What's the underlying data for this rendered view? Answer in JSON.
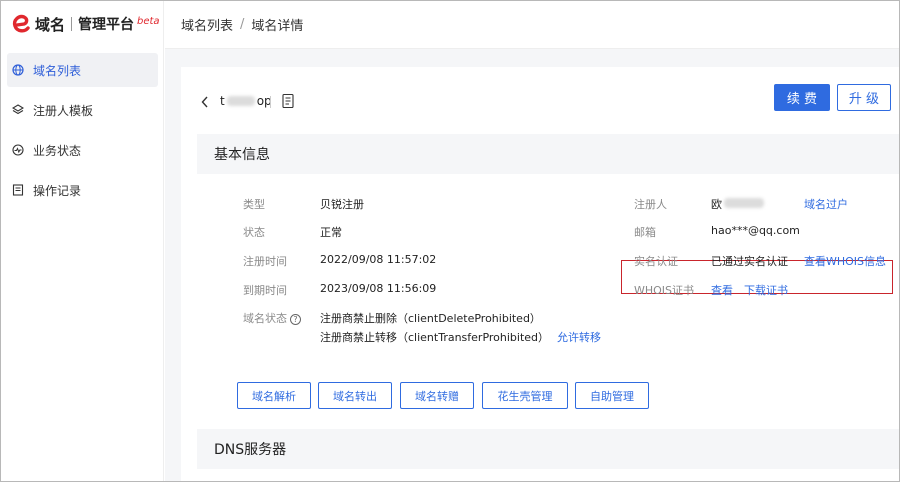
{
  "logo": {
    "brand": "域名",
    "platform": "管理平台",
    "beta": "beta"
  },
  "sidebar": {
    "items": [
      {
        "label": "域名列表",
        "icon": "globe-icon",
        "active": true
      },
      {
        "label": "注册人模板",
        "icon": "layers-icon",
        "active": false
      },
      {
        "label": "业务状态",
        "icon": "pulse-icon",
        "active": false
      },
      {
        "label": "操作记录",
        "icon": "log-icon",
        "active": false
      }
    ]
  },
  "breadcrumb": {
    "items": [
      "域名列表",
      "域名详情"
    ],
    "sep": "/"
  },
  "domain": {
    "prefix": "t",
    "suffix": "op"
  },
  "actions": {
    "renew": "续 费",
    "upgrade": "升 级"
  },
  "basic": {
    "title": "基本信息",
    "type_label": "类型",
    "type_value": "贝锐注册",
    "status_label": "状态",
    "status_value": "正常",
    "reg_time_label": "注册时间",
    "reg_time_value": "2022/09/08 11:57:02",
    "exp_time_label": "到期时间",
    "exp_time_value": "2023/09/08 11:56:09",
    "domain_status_label": "域名状态",
    "domain_status_1": "注册商禁止删除（clientDeleteProhibited）",
    "domain_status_2": "注册商禁止转移（clientTransferProhibited）",
    "allow_transfer": "允许转移",
    "registrant_label": "注册人",
    "registrant_value": "欧",
    "transfer_link": "域名过户",
    "email_label": "邮箱",
    "email_value": "hao***@qq.com",
    "realname_label": "实名认证",
    "realname_value": "已通过实名认证",
    "whois_link": "查看WHOIS信息",
    "whois_cert_label": "WHOIS证书",
    "view_link": "查看",
    "download_link": "下载证书"
  },
  "ops": [
    "域名解析",
    "域名转出",
    "域名转赠",
    "花生壳管理",
    "自助管理"
  ],
  "dns": {
    "title": "DNS服务器"
  },
  "colors": {
    "accent": "#2f6be0",
    "brand_red": "#e0282e",
    "highlight": "#c9252c"
  }
}
